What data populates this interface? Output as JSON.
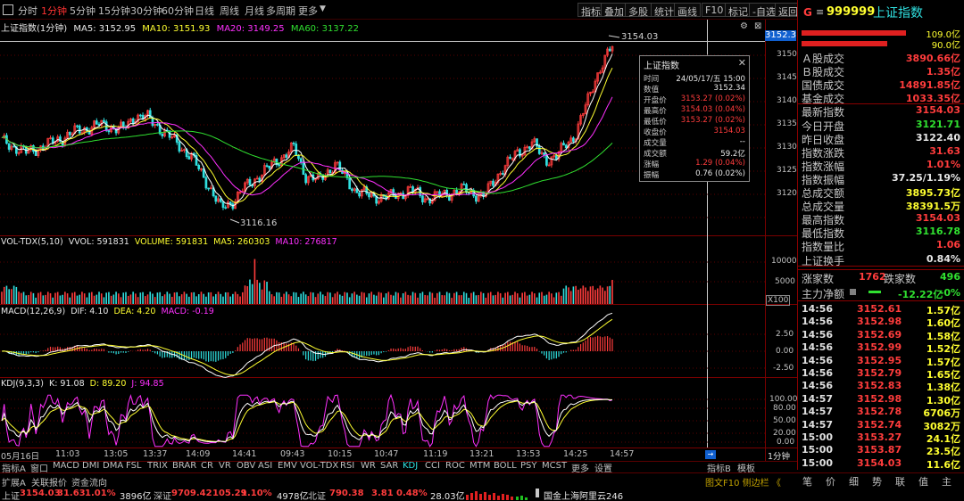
{
  "toolbar": {
    "left_items": [
      "分时",
      "1分钟",
      "5分钟",
      "15分钟",
      "30分钟",
      "60分钟",
      "日线",
      "周线",
      "月线",
      "多周期",
      "更多"
    ],
    "selected": "1分钟",
    "right_items": [
      "指标",
      "叠加",
      "多股",
      "统计",
      "画线",
      "F10",
      "标记",
      "-自选",
      "返回"
    ]
  },
  "main_chart": {
    "header": {
      "title": "上证指数(1分钟)",
      "ma5": "MA5: 3152.95",
      "ma10": "MA10: 3151.93",
      "ma20": "MA20: 3149.25",
      "ma60": "MA60: 3137.22"
    },
    "price_ticks": [
      "3150",
      "3145",
      "3140",
      "3135",
      "3130",
      "3125",
      "3120"
    ],
    "current_price_box": "3152.3",
    "high_label": "3154.03",
    "low_label": "3116.16",
    "tooltip": {
      "title": "上证指数",
      "rows": [
        {
          "k": "时间",
          "v": "24/05/17/五 15:00"
        },
        {
          "k": "数值",
          "v": "3152.34"
        },
        {
          "k": "开盘价",
          "v": "3153.27 (0.02%)"
        },
        {
          "k": "最高价",
          "v": "3154.03 (0.04%)"
        },
        {
          "k": "最低价",
          "v": "3153.27 (0.02%)"
        },
        {
          "k": "收盘价",
          "v": "3154.03"
        },
        {
          "k": "成交量",
          "v": "--"
        },
        {
          "k": "成交额",
          "v": "59.2亿"
        },
        {
          "k": "涨幅",
          "v": "1.29 (0.04%)"
        },
        {
          "k": "振幅",
          "v": "0.76 (0.02%)"
        }
      ]
    }
  },
  "volume_panel": {
    "header": {
      "name": "VOL-TDX(5,10)",
      "vvol": "VVOL: 591831",
      "volume": "VOLUME: 591831",
      "ma5": "MA5: 260303",
      "ma10": "MA10: 276817"
    },
    "ticks": [
      "10000",
      "5000"
    ],
    "unit": "X100"
  },
  "macd_panel": {
    "header": {
      "name": "MACD(12,26,9)",
      "dif": "DIF: 4.10",
      "dea": "DEA: 4.20",
      "macd": "MACD: -0.19"
    },
    "ticks": [
      "2.50",
      "0.00",
      "-2.50"
    ]
  },
  "kdj_panel": {
    "header": {
      "name": "KDJ(9,3,3)",
      "k": "K: 91.08",
      "d": "D: 89.20",
      "j": "J: 94.85"
    },
    "ticks": [
      "100.00",
      "80.00",
      "50.00",
      "20.00",
      "0.00"
    ]
  },
  "time_axis": [
    "05月16日",
    "11:03",
    "13:05",
    "13:37",
    "14:09",
    "14:41",
    "09:43",
    "10:15",
    "10:47",
    "11:19",
    "13:21",
    "13:53",
    "14:25",
    "14:57"
  ],
  "time_axis_right": "1分钟",
  "indicator_tabs": [
    "指标A",
    "窗口",
    "MACD",
    "DMI",
    "DMA",
    "FSL",
    "TRIX",
    "BRAR",
    "CR",
    "VR",
    "OBV",
    "ASI",
    "EMV",
    "VOL-TDX",
    "RSI",
    "WR",
    "SAR",
    "KDJ",
    "CCI",
    "ROC",
    "MTM",
    "BOLL",
    "PSY",
    "MCST",
    "更多",
    "设置"
  ],
  "indicator_selected": "KDJ",
  "indicator_right": [
    "指标B",
    "模板"
  ],
  "bottom_bar": {
    "tabs": [
      "扩展A",
      "关联报价",
      "资金流向"
    ],
    "sh_label": "上证",
    "sh_price": "3154.03",
    "sh_chg": "31.63",
    "sh_pct": "1.01%",
    "sh_amt": "3896亿",
    "sz_label": "深证",
    "sz_price": "9709.42",
    "sz_chg": "105.29",
    "sz_pct": "1.10%",
    "sz_amt": "4978亿",
    "bz_label": "北证",
    "bz_price": "790.38",
    "bz_chg": "3.81",
    "bz_pct": "0.48%",
    "bz_amt": "28.03亿",
    "broker": "国金上海阿里云246",
    "right_label": "图文F10 侧边栏 《",
    "right_tabs": [
      "笔",
      "价",
      "细",
      "势",
      "联",
      "值",
      "主"
    ]
  },
  "right_panel": {
    "code": "999999",
    "name": "上证指数",
    "bar_values": [
      "109.0亿",
      "90.0亿"
    ],
    "stats": [
      {
        "label": "Ａ股成交",
        "value": "3890.66亿",
        "color": "#ff3c3c"
      },
      {
        "label": "Ｂ股成交",
        "value": "1.35亿",
        "color": "#ff3c3c"
      },
      {
        "label": "国债成交",
        "value": "14891.85亿",
        "color": "#ff3c3c"
      },
      {
        "label": "基金成交",
        "value": "1033.35亿",
        "color": "#ff3c3c"
      },
      {
        "label": "最新指数",
        "value": "3154.03",
        "color": "#ff3c3c"
      },
      {
        "label": "今日开盘",
        "value": "3121.71",
        "color": "#30e030"
      },
      {
        "label": "昨日收盘",
        "value": "3122.40",
        "color": "#e8e8e8"
      },
      {
        "label": "指数涨跌",
        "value": "31.63",
        "color": "#ff3c3c"
      },
      {
        "label": "指数涨幅",
        "value": "1.01%",
        "color": "#ff3c3c"
      },
      {
        "label": "指数振幅",
        "value": "37.25/1.19%",
        "color": "#e8e8e8"
      },
      {
        "label": "总成交额",
        "value": "3895.73亿",
        "color": "#ffff30"
      },
      {
        "label": "总成交量",
        "value": "38391.5万",
        "color": "#ffff30"
      },
      {
        "label": "最高指数",
        "value": "3154.03",
        "color": "#ff3c3c"
      },
      {
        "label": "最低指数",
        "value": "3116.78",
        "color": "#30e030"
      },
      {
        "label": "指数量比",
        "value": "1.06",
        "color": "#ff3c3c"
      },
      {
        "label": "上证换手",
        "value": "0.84%",
        "color": "#e8e8e8"
      }
    ],
    "rise_label": "涨家数",
    "rise_value": "1762",
    "fall_label": "跌家数",
    "fall_value": "496",
    "flow_label": "主力净额",
    "flow_value": "-12.22亿",
    "flow_pct": "-0%",
    "ticks": [
      {
        "t": "14:56",
        "p": "3152.61",
        "v": "1.57亿"
      },
      {
        "t": "14:56",
        "p": "3152.98",
        "v": "1.60亿"
      },
      {
        "t": "14:56",
        "p": "3152.69",
        "v": "1.58亿"
      },
      {
        "t": "14:56",
        "p": "3152.99",
        "v": "1.52亿"
      },
      {
        "t": "14:56",
        "p": "3152.95",
        "v": "1.57亿"
      },
      {
        "t": "14:56",
        "p": "3152.79",
        "v": "1.65亿"
      },
      {
        "t": "14:56",
        "p": "3152.83",
        "v": "1.38亿"
      },
      {
        "t": "14:57",
        "p": "3152.98",
        "v": "1.30亿"
      },
      {
        "t": "14:57",
        "p": "3152.78",
        "v": "6706万"
      },
      {
        "t": "14:57",
        "p": "3152.74",
        "v": "3082万"
      },
      {
        "t": "15:00",
        "p": "3153.27",
        "v": "24.1亿"
      },
      {
        "t": "15:00",
        "p": "3153.87",
        "v": "23.5亿"
      },
      {
        "t": "15:00",
        "p": "3154.03",
        "v": "11.6亿"
      }
    ]
  },
  "colors": {
    "up": "#ff3c3c",
    "down": "#30e0e0",
    "ma5": "#ffffff",
    "ma10": "#ffff30",
    "ma20": "#ff30ff",
    "ma60": "#30e030",
    "grid": "#7a0000"
  }
}
